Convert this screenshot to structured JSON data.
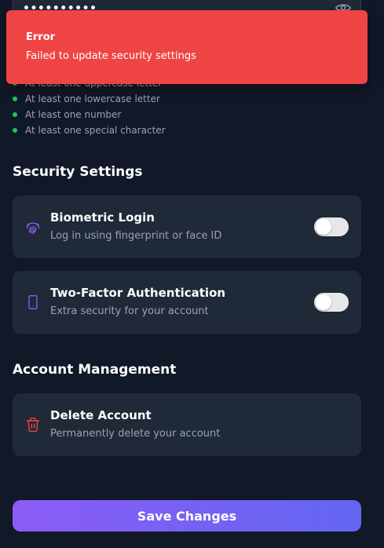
{
  "password": {
    "masked_value": "••••••••••",
    "toggle_icon": "eye-icon"
  },
  "requirements": [
    {
      "label": "At least one uppercase letter",
      "met": true
    },
    {
      "label": "At least one lowercase letter",
      "met": true
    },
    {
      "label": "At least one number",
      "met": true
    },
    {
      "label": "At least one special character",
      "met": true
    }
  ],
  "security": {
    "title": "Security Settings",
    "biometric": {
      "title": "Biometric Login",
      "subtitle": "Log in using fingerprint or face ID",
      "icon": "fingerprint-icon",
      "enabled": false
    },
    "two_factor": {
      "title": "Two-Factor Authentication",
      "subtitle": "Extra security for your account",
      "icon": "smartphone-icon",
      "enabled": false
    }
  },
  "account": {
    "title": "Account Management",
    "delete": {
      "title": "Delete Account",
      "subtitle": "Permanently delete your account",
      "icon": "trash-icon"
    }
  },
  "save_label": "Save Changes",
  "toast": {
    "title": "Error",
    "message": "Failed to update security settings"
  },
  "colors": {
    "background": "#111827",
    "card": "#1f2937",
    "accent_start": "#8b5cf6",
    "accent_end": "#6366f1",
    "error": "#ef4444",
    "success": "#22c55e",
    "danger_icon": "#ef4444",
    "icon_accent": "#8b5cf6"
  }
}
